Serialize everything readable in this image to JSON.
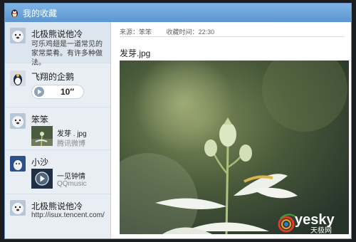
{
  "window": {
    "title": "我的收藏"
  },
  "sidebar": {
    "items": [
      {
        "name": "北极熊说他冷",
        "text": "可乐鸡翅是一道常见的家常菜肴。有许多种做法。"
      },
      {
        "name": "飞翔的企鹅",
        "voice_duration": "10″"
      },
      {
        "name": "笨笨",
        "file_title": "发芽 . jpg",
        "file_source": "腾讯微博"
      },
      {
        "name": "小沙",
        "music_title": "一见钟情",
        "music_source": "QQmusic"
      },
      {
        "name": "北极熊说他冷",
        "link": "http://isux.tencent.com/"
      }
    ]
  },
  "content": {
    "source_label": "来源：",
    "source_value": "笨笨",
    "time_label": "收藏时间：",
    "time_value": "22:30",
    "file_title": "发芽.jpg"
  },
  "watermark": {
    "text": "yesky",
    "subtext": "天极网"
  }
}
